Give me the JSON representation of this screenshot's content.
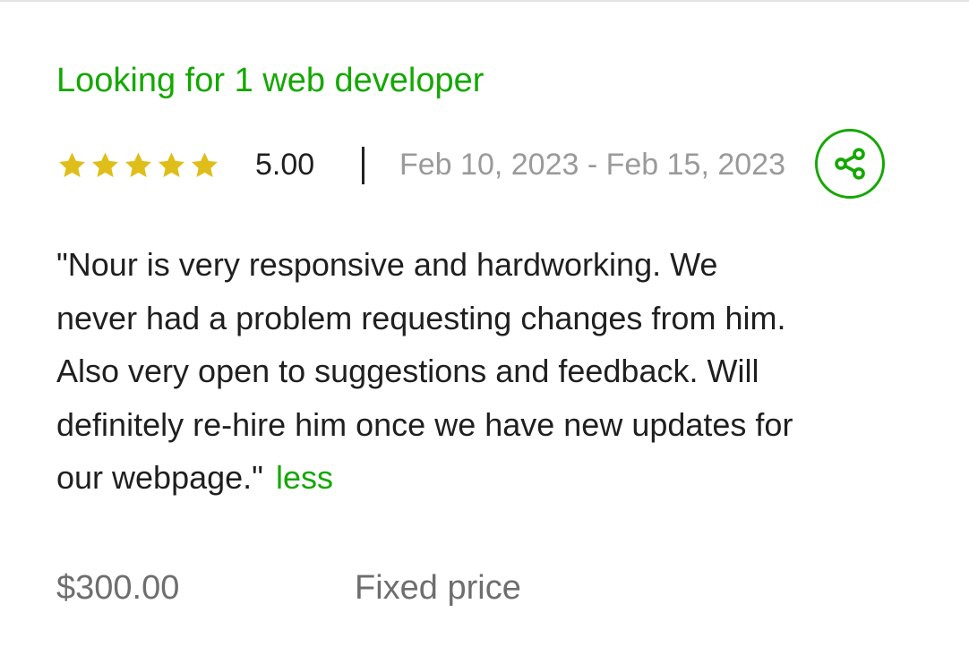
{
  "job": {
    "title": "Looking for 1 web developer"
  },
  "rating": {
    "value": "5.00",
    "stars": 5,
    "star_color": "#e0be1a"
  },
  "dates": {
    "range": "Feb 10, 2023 - Feb 15, 2023"
  },
  "share": {
    "icon": "share-icon",
    "accent": "#14a800"
  },
  "feedback": {
    "lines": [
      "\"Nour is very responsive and hardworking. We",
      "never had a problem requesting changes from him.",
      "Also very open to suggestions and feedback. Will",
      "definitely re-hire him once we have new updates for",
      "our webpage.\""
    ],
    "less_label": "less"
  },
  "contract": {
    "amount": "$300.00",
    "type": "Fixed price"
  }
}
